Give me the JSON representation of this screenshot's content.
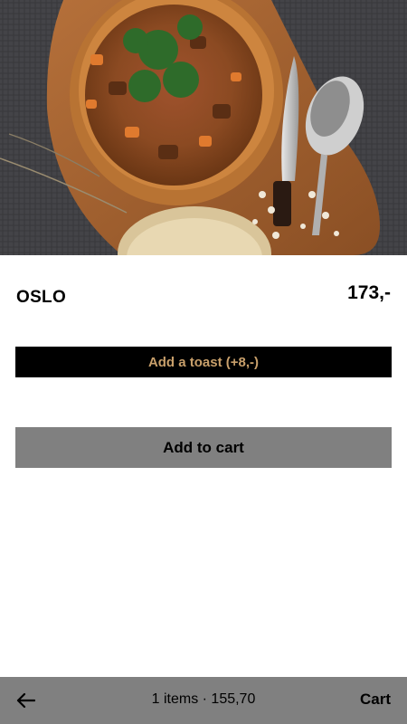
{
  "hero": {
    "image_icon": "stew-in-bread-bowl-photo"
  },
  "product": {
    "name": "OSLO",
    "price": "173,-"
  },
  "actions": {
    "toast_label": "Add a toast (+8,-)",
    "add_to_cart_label": "Add to cart"
  },
  "bottom_bar": {
    "back_icon": "arrow-left-icon",
    "summary": "1 items · 155,70",
    "cart_label": "Cart"
  },
  "colors": {
    "toast_button_bg": "#000000",
    "toast_button_text": "#c9a06b",
    "cart_button_bg": "#808080",
    "bottom_bar_bg": "#808080"
  }
}
